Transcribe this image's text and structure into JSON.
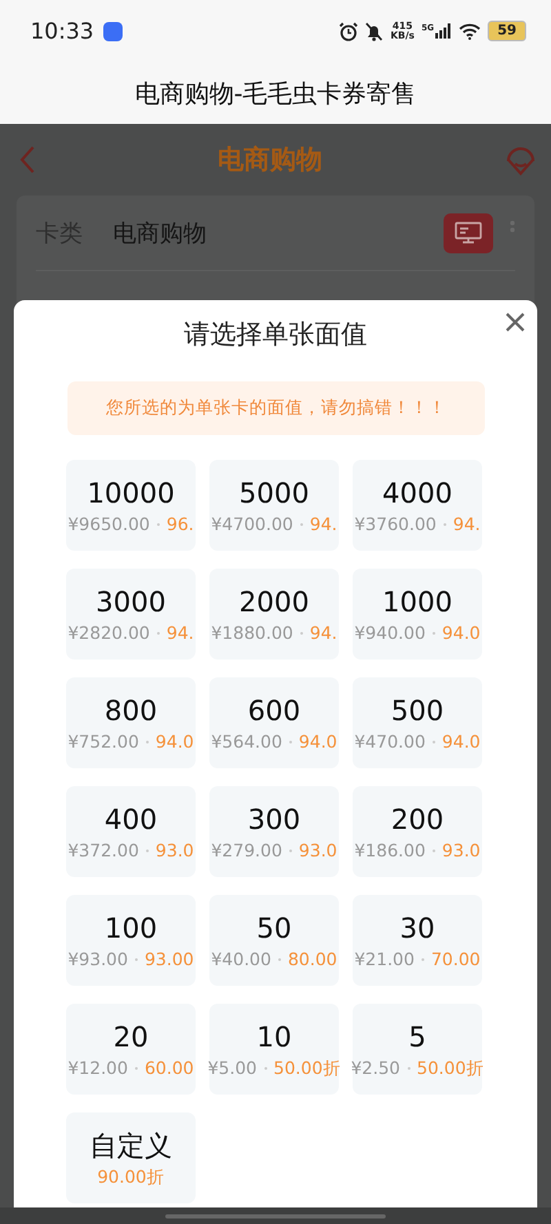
{
  "status_bar": {
    "time": "10:33",
    "net_speed": "415",
    "net_speed_unit": "KB/s",
    "network": "5G",
    "battery": "59"
  },
  "title_bar": {
    "title": "电商购物-毛毛虫卡券寄售"
  },
  "page": {
    "title": "电商购物",
    "form": [
      {
        "label": "卡类",
        "value": "电商购物"
      }
    ]
  },
  "dialog": {
    "title": "请选择单张面值",
    "notice": "您所选的为单张卡的面值，请勿搞错！！！",
    "options": [
      {
        "face_value": "10000",
        "price": "¥9650.00",
        "discount": "96."
      },
      {
        "face_value": "5000",
        "price": "¥4700.00",
        "discount": "94."
      },
      {
        "face_value": "4000",
        "price": "¥3760.00",
        "discount": "94."
      },
      {
        "face_value": "3000",
        "price": "¥2820.00",
        "discount": "94."
      },
      {
        "face_value": "2000",
        "price": "¥1880.00",
        "discount": "94."
      },
      {
        "face_value": "1000",
        "price": "¥940.00",
        "discount": "94.0"
      },
      {
        "face_value": "800",
        "price": "¥752.00",
        "discount": "94.0"
      },
      {
        "face_value": "600",
        "price": "¥564.00",
        "discount": "94.0"
      },
      {
        "face_value": "500",
        "price": "¥470.00",
        "discount": "94.0"
      },
      {
        "face_value": "400",
        "price": "¥372.00",
        "discount": "93.0"
      },
      {
        "face_value": "300",
        "price": "¥279.00",
        "discount": "93.0"
      },
      {
        "face_value": "200",
        "price": "¥186.00",
        "discount": "93.0"
      },
      {
        "face_value": "100",
        "price": "¥93.00",
        "discount": "93.00"
      },
      {
        "face_value": "50",
        "price": "¥40.00",
        "discount": "80.00"
      },
      {
        "face_value": "30",
        "price": "¥21.00",
        "discount": "70.00"
      },
      {
        "face_value": "20",
        "price": "¥12.00",
        "discount": "60.00"
      },
      {
        "face_value": "10",
        "price": "¥5.00",
        "discount": "50.00折"
      },
      {
        "face_value": "5",
        "price": "¥2.50",
        "discount": "50.00折"
      },
      {
        "face_value": "自定义",
        "discount": "90.00折"
      }
    ]
  }
}
